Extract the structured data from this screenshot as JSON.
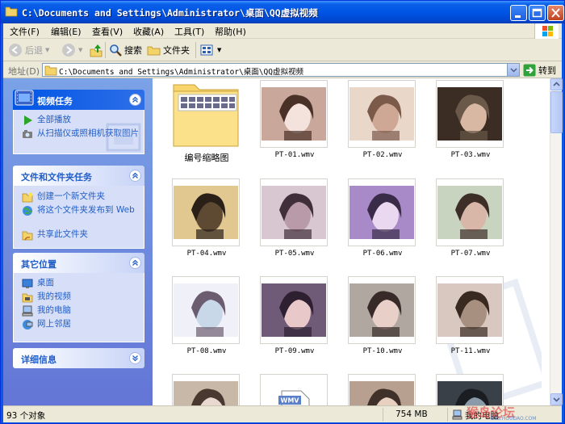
{
  "window": {
    "title": "C:\\Documents and Settings\\Administrator\\桌面\\QQ虚拟视频"
  },
  "menu": [
    "文件(F)",
    "编辑(E)",
    "查看(V)",
    "收藏(A)",
    "工具(T)",
    "帮助(H)"
  ],
  "toolbar": {
    "back": "后退",
    "search": "搜索",
    "folders": "文件夹"
  },
  "address": {
    "label": "地址(D)",
    "value": "C:\\Documents and Settings\\Administrator\\桌面\\QQ虚拟视频",
    "go": "转到"
  },
  "tasks": {
    "video": {
      "title": "视频任务",
      "items": [
        "全部播放",
        "从扫描仪或照相机获取图片"
      ]
    },
    "file": {
      "title": "文件和文件夹任务",
      "items": [
        "创建一个新文件夹",
        "将这个文件夹发布到 Web",
        "共享此文件夹"
      ]
    },
    "places": {
      "title": "其它位置",
      "items": [
        "桌面",
        "我的视频",
        "我的电脑",
        "网上邻居"
      ]
    },
    "details": {
      "title": "详细信息"
    }
  },
  "files": [
    {
      "name": "编号缩略图",
      "kind": "folder"
    },
    {
      "name": "PT-01.wmv"
    },
    {
      "name": "PT-02.wmv"
    },
    {
      "name": "PT-03.wmv"
    },
    {
      "name": "PT-04.wmv"
    },
    {
      "name": "PT-05.wmv"
    },
    {
      "name": "PT-06.wmv"
    },
    {
      "name": "PT-07.wmv"
    },
    {
      "name": "PT-08.wmv"
    },
    {
      "name": "PT-09.wmv"
    },
    {
      "name": "PT-10.wmv"
    },
    {
      "name": "PT-11.wmv"
    },
    {
      "name": ""
    },
    {
      "name": "",
      "kind": "wmv-icon",
      "icon_text": "WMV"
    },
    {
      "name": ""
    },
    {
      "name": ""
    }
  ],
  "status": {
    "count": "93 个对象",
    "size": "754 MB",
    "location": "我的电脑"
  },
  "watermark": {
    "main": "猴岛论坛",
    "sub": "BBS.HOUDAO.COM"
  },
  "colors": {
    "title_blue": "#0055e5",
    "task_link": "#215dc6",
    "pane_top": "#7ba2e7",
    "pane_bottom": "#6375d6"
  }
}
